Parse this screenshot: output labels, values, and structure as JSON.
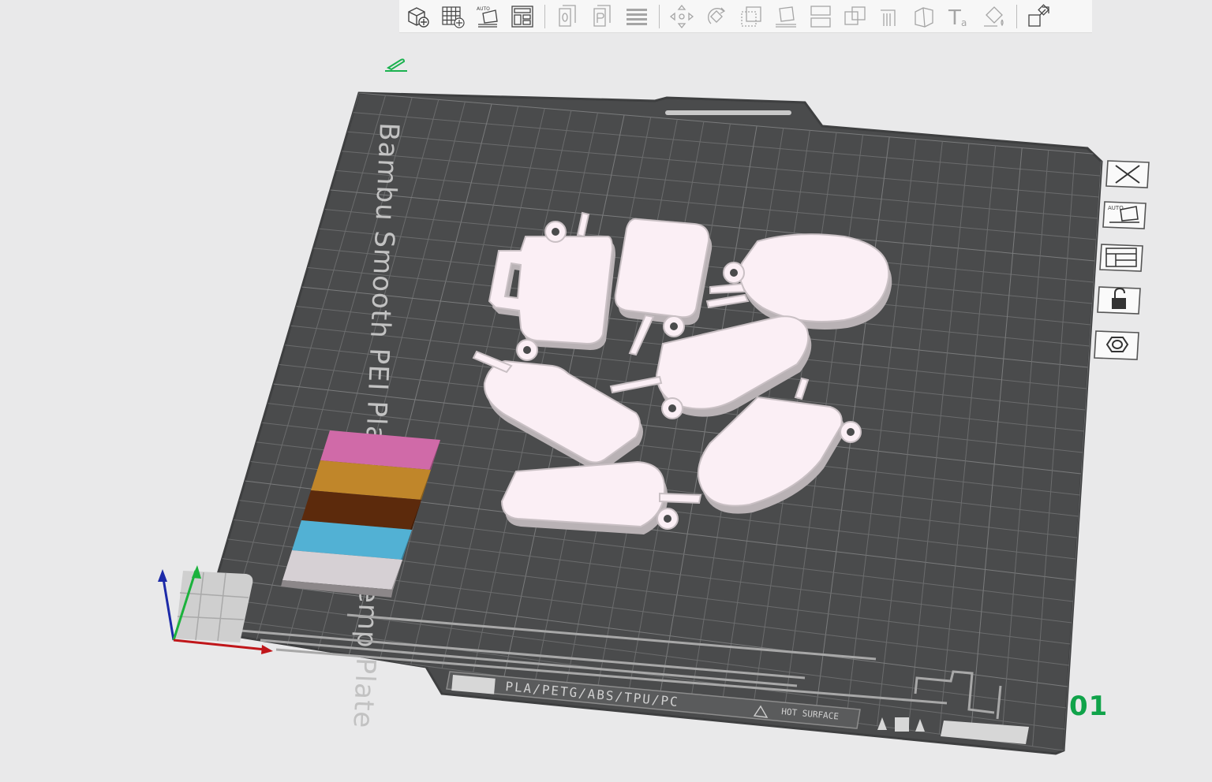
{
  "toolbar": {
    "buttons": [
      {
        "name": "add-object-icon"
      },
      {
        "name": "add-plate-icon"
      },
      {
        "name": "auto-orient-icon",
        "label": "AUTO"
      },
      {
        "name": "arrange-icon"
      },
      {
        "name": "split-objects-icon"
      },
      {
        "name": "split-parts-icon"
      },
      {
        "name": "layers-icon"
      },
      {
        "name": "move-icon"
      },
      {
        "name": "rotate-icon"
      },
      {
        "name": "scale-icon"
      },
      {
        "name": "lay-on-face-icon"
      },
      {
        "name": "cut-icon"
      },
      {
        "name": "mesh-boolean-icon"
      },
      {
        "name": "support-paint-icon"
      },
      {
        "name": "seam-paint-icon"
      },
      {
        "name": "text-icon"
      },
      {
        "name": "color-paint-icon"
      },
      {
        "name": "assembly-view-icon"
      }
    ]
  },
  "plate": {
    "name_text": "Bambu Smooth PEI Plate / High Temp Plate",
    "materials_text": "PLA/PETG/ABS/TPU/PC",
    "hot_surface_text": "HOT SURFACE",
    "plate_number": "01"
  },
  "plate_tools": [
    {
      "name": "close-plate-icon"
    },
    {
      "name": "auto-orient-plate-icon",
      "label": "AUTO"
    },
    {
      "name": "arrange-plate-icon"
    },
    {
      "name": "lock-plate-icon"
    },
    {
      "name": "plate-settings-icon"
    }
  ],
  "colors": {
    "plate": "#4a4b4c",
    "grid": "#6c6d6e",
    "objects": "#fbeff5",
    "accent": "#10a34a",
    "swatches": [
      "#d06aa8",
      "#c0862a",
      "#5c2a0c",
      "#52b1d4",
      "#d6d0d4"
    ]
  }
}
